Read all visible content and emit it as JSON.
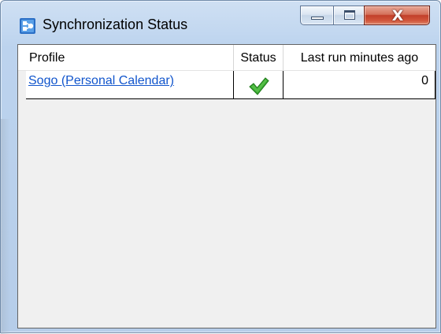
{
  "window": {
    "title": "Synchronization Status",
    "app_icon": "sync-status-icon",
    "controls": {
      "minimize_icon": "minimize-icon",
      "maximize_icon": "maximize-icon",
      "close_glyph": "X"
    }
  },
  "grid": {
    "columns": [
      {
        "label": "Profile"
      },
      {
        "label": "Status"
      },
      {
        "label": "Last run minutes ago"
      }
    ],
    "rows": [
      {
        "profile": "Sogo (Personal Calendar)",
        "status_icon": "checkmark-icon",
        "status_color": "#3aa832",
        "last_run_minutes_ago": "0"
      }
    ]
  },
  "colors": {
    "link": "#1155cc",
    "close_button": "#c2402a",
    "title_bar": "#bcd3ee"
  }
}
